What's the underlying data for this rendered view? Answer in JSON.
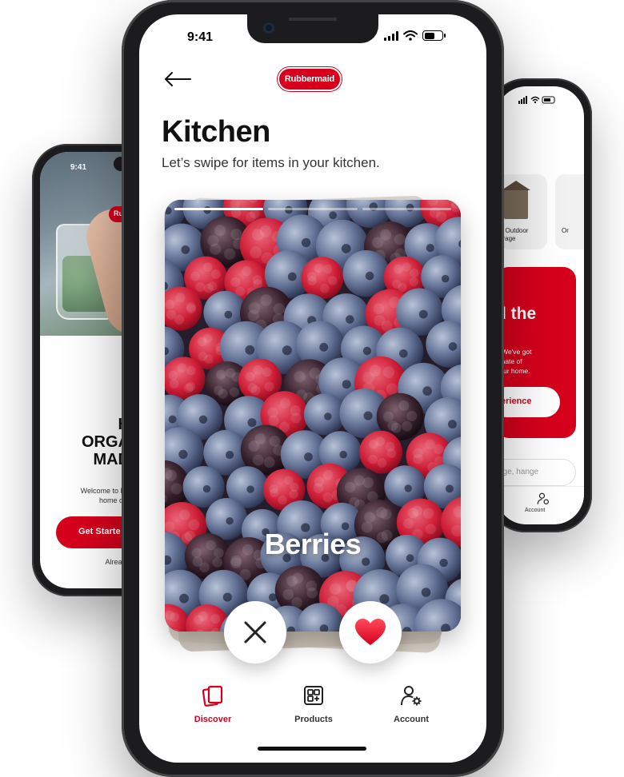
{
  "left_phone": {
    "time": "9:41",
    "logo_text": "Ru",
    "headline": "H\nORGA\nMAD",
    "welcome": "Welcome to Ru\nhome org",
    "button_label": "Get Starte",
    "footer_text": "Already"
  },
  "right_phone": {
    "category_fragment": "y",
    "cards": [
      {
        "label": "& Outdoor\norage"
      },
      {
        "label": "Or"
      }
    ],
    "promo_title": "t\nd the",
    "promo_text": "? We've got\ntimate of\n your home.",
    "promo_button": "erience",
    "search_fragment": "nge, hange",
    "nav_account": "Account"
  },
  "main_phone": {
    "status": {
      "time": "9:41"
    },
    "brand": "Rubbermaid",
    "title": "Kitchen",
    "subtitle": "Let’s swipe for items in your kitchen.",
    "card": {
      "label": "Berries",
      "progress_total": 3,
      "progress_active": 1
    },
    "actions": {
      "reject_icon": "close-icon",
      "like_icon": "heart-icon"
    },
    "tabs": [
      {
        "id": "discover",
        "label": "Discover",
        "icon": "cards-icon",
        "active": true
      },
      {
        "id": "products",
        "label": "Products",
        "icon": "grid-icon",
        "active": false
      },
      {
        "id": "account",
        "label": "Account",
        "icon": "account-settings-icon",
        "active": false
      }
    ]
  },
  "colors": {
    "brand_red": "#d6001c",
    "text_dark": "#111111",
    "text_muted": "#333333"
  }
}
